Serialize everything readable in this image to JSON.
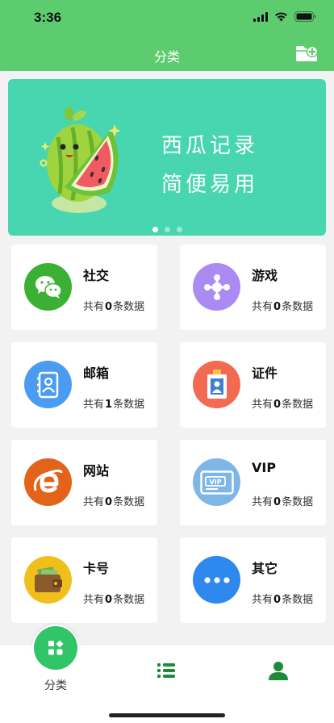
{
  "status_bar": {
    "time": "3:36"
  },
  "header": {
    "title": "分类"
  },
  "banner": {
    "line1": "西瓜记录",
    "line2": "简便易用",
    "page_count": 3,
    "active_page": 0
  },
  "categories": [
    {
      "name": "社交",
      "prefix": "共有",
      "count": "0",
      "suffix": "条数据",
      "icon": "wechat-icon",
      "color": "#3cb035"
    },
    {
      "name": "游戏",
      "prefix": "共有",
      "count": "0",
      "suffix": "条数据",
      "icon": "gamepad-icon",
      "color": "#a98bf3"
    },
    {
      "name": "邮箱",
      "prefix": "共有",
      "count": "1",
      "suffix": "条数据",
      "icon": "address-book-icon",
      "color": "#4b9cf0"
    },
    {
      "name": "证件",
      "prefix": "共有",
      "count": "0",
      "suffix": "条数据",
      "icon": "id-badge-icon",
      "color": "#f36a53"
    },
    {
      "name": "网站",
      "prefix": "共有",
      "count": "0",
      "suffix": "条数据",
      "icon": "browser-e-icon",
      "color": "#e4631a"
    },
    {
      "name": "VIP",
      "prefix": "共有",
      "count": "0",
      "suffix": "条数据",
      "icon": "vip-card-icon",
      "color": "#7eb6e8"
    },
    {
      "name": "卡号",
      "prefix": "共有",
      "count": "0",
      "suffix": "条数据",
      "icon": "wallet-icon",
      "color": "#f0bf1c"
    },
    {
      "name": "其它",
      "prefix": "共有",
      "count": "0",
      "suffix": "条数据",
      "icon": "more-dots-icon",
      "color": "#2e88ee"
    }
  ],
  "tabbar": {
    "active_label": "分类",
    "accent": "#32c567"
  }
}
